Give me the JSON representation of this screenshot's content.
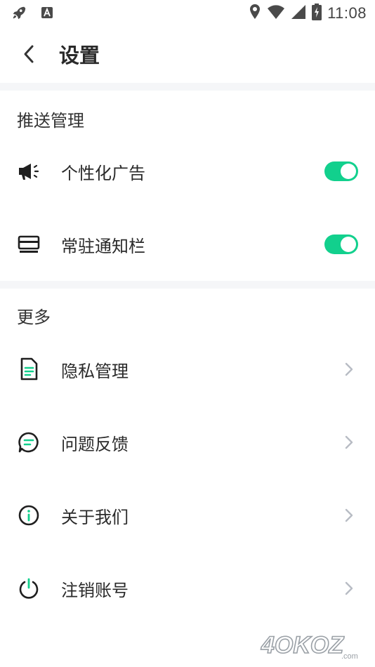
{
  "status_bar": {
    "time": "11:08",
    "icons": [
      "rocket-icon",
      "a-badge-icon",
      "location-icon",
      "wifi-icon",
      "signal-icon",
      "battery-charging-icon"
    ]
  },
  "header": {
    "title": "设置",
    "back_icon": "chevron-left-icon"
  },
  "sections": {
    "push": {
      "title": "推送管理",
      "items": [
        {
          "label": "个性化广告",
          "icon": "megaphone-icon",
          "toggle": "on"
        },
        {
          "label": "常驻通知栏",
          "icon": "notification-bar-icon",
          "toggle": "on"
        }
      ]
    },
    "more": {
      "title": "更多",
      "items": [
        {
          "label": "隐私管理",
          "icon": "document-icon"
        },
        {
          "label": "问题反馈",
          "icon": "chat-bubble-icon"
        },
        {
          "label": "关于我们",
          "icon": "info-icon"
        },
        {
          "label": "注销账号",
          "icon": "power-icon"
        }
      ]
    }
  },
  "colors": {
    "accent": "#12d08d",
    "section_gap": "#f5f6f8",
    "text": "#2a2a2a",
    "chevron": "#b8bcc4"
  },
  "watermark": "4OKOZ.com"
}
